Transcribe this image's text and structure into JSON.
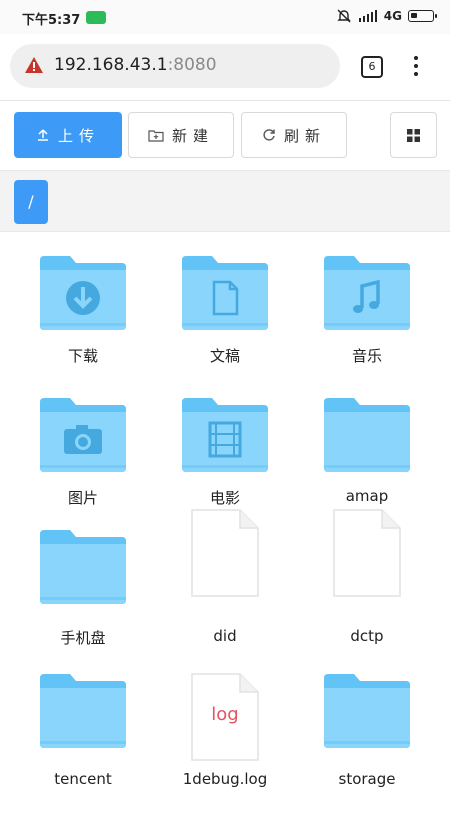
{
  "status": {
    "time": "下午5:37",
    "network": "4G",
    "battery_level": 0.3
  },
  "browser": {
    "host": "192.168.43.1",
    "port": ":8080",
    "tab_count": "6"
  },
  "toolbar": {
    "upload": "上传",
    "new": "新建",
    "refresh": "刷新"
  },
  "breadcrumb": {
    "root": "/"
  },
  "colors": {
    "accent": "#3d9bf7",
    "folder": "#62c3f7",
    "folder_light": "#8ad5fb",
    "log_text": "#e05561"
  },
  "files": [
    {
      "name": "下载",
      "type": "folder",
      "glyph": "download-icon"
    },
    {
      "name": "文稿",
      "type": "folder",
      "glyph": "document-icon"
    },
    {
      "name": "音乐",
      "type": "folder",
      "glyph": "music-icon"
    },
    {
      "name": "图片",
      "type": "folder",
      "glyph": "camera-icon"
    },
    {
      "name": "电影",
      "type": "folder",
      "glyph": "film-icon"
    },
    {
      "name": "amap",
      "type": "folder"
    },
    {
      "name": "手机盘",
      "type": "folder"
    },
    {
      "name": "did",
      "type": "file"
    },
    {
      "name": "dctp",
      "type": "file"
    },
    {
      "name": "tencent",
      "type": "folder"
    },
    {
      "name": "1debug.log",
      "type": "file",
      "badge": "log"
    },
    {
      "name": "storage",
      "type": "folder"
    }
  ]
}
